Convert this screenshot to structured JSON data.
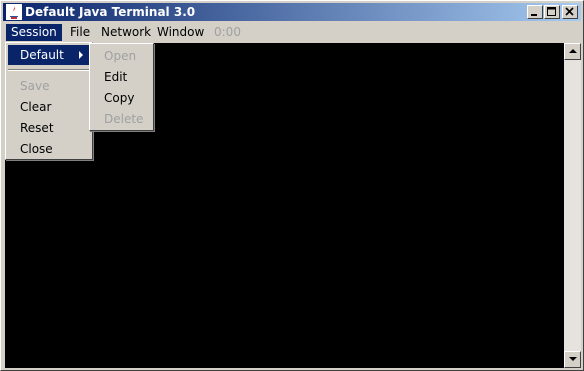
{
  "window": {
    "title": "Default Java Terminal 3.0"
  },
  "title_buttons": {
    "minimize": "minimize-icon",
    "maximize": "maximize-icon",
    "close": "close-icon"
  },
  "menubar": {
    "session": "Session",
    "file": "File",
    "network": "Network",
    "window": "Window",
    "timer": "0:00"
  },
  "session_menu": {
    "default": "Default",
    "save": "Save",
    "clear": "Clear",
    "reset": "Reset",
    "close": "Close"
  },
  "default_submenu": {
    "open": "Open",
    "edit": "Edit",
    "copy": "Copy",
    "delete": "Delete"
  },
  "colors": {
    "menu_highlight": "#0a246a",
    "terminal_bg": "#000000",
    "disabled_text": "#a0a0a0"
  }
}
